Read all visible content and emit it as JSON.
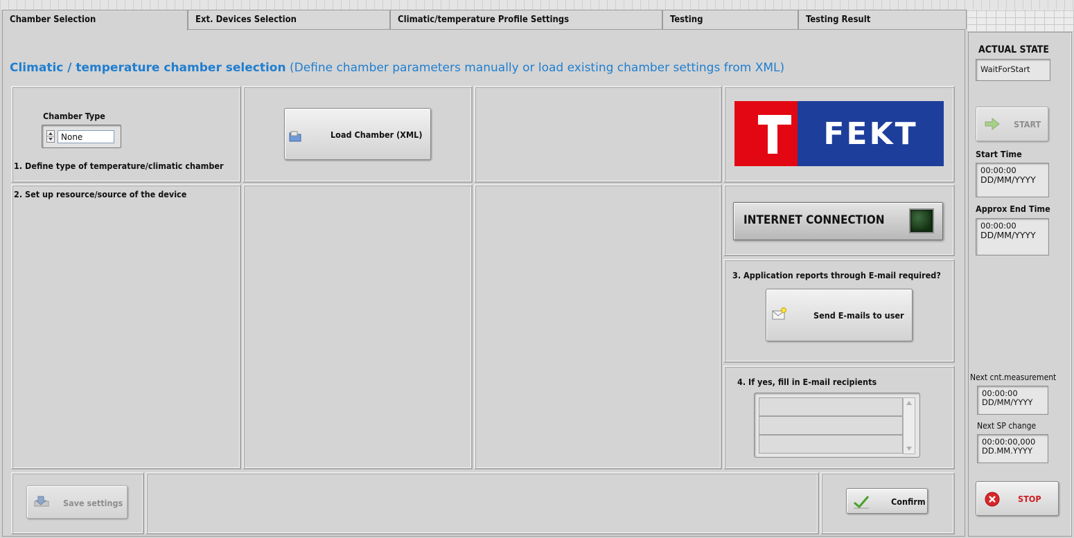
{
  "tabs": [
    {
      "label": "Chamber Selection",
      "active": true
    },
    {
      "label": "Ext. Devices Selection",
      "active": false
    },
    {
      "label": "Climatic/temperature Profile Settings",
      "active": false
    },
    {
      "label": "Testing",
      "active": false
    },
    {
      "label": "Testing Result",
      "active": false
    }
  ],
  "heading": {
    "title": "Climatic / temperature chamber selection",
    "subtitle": "(Define chamber parameters manually or load existing chamber settings from XML)"
  },
  "chamber": {
    "type_label": "Chamber Type",
    "type_value": "None",
    "step1": "1. Define type of temperature/climatic chamber",
    "step2": "2. Set up resource/source of the device",
    "load_button": "Load Chamber (XML)"
  },
  "logo": {
    "text": "FEKT",
    "red": "#e30713",
    "blue": "#1d3e9b"
  },
  "internet": {
    "label": "INTERNET CONNECTION",
    "led_state": "off"
  },
  "email": {
    "step3": "3. Application reports through E-mail required?",
    "send_button": "Send E-mails to user",
    "step4": "4. If yes, fill in E-mail recipients",
    "recipients": [
      "",
      "",
      ""
    ]
  },
  "footer": {
    "save_button": "Save settings",
    "confirm_button": "Confirm"
  },
  "status": {
    "actual_state_label": "ACTUAL STATE",
    "actual_state_value": "WaitForStart",
    "start_button": "START",
    "start_time_label": "Start Time",
    "start_time_value": "00:00:00",
    "start_date_value": "DD/MM/YYYY",
    "end_time_label": "Approx End Time",
    "end_time_value": "00:00:00",
    "end_date_value": "DD/MM/YYYY",
    "next_meas_label": "Next cnt.measurement",
    "next_meas_time": "00:00:00",
    "next_meas_date": "DD/MM/YYYY",
    "next_sp_label": "Next SP change",
    "next_sp_time": "00:00:00,000",
    "next_sp_date": "DD.MM.YYYY",
    "stop_button": "STOP"
  }
}
